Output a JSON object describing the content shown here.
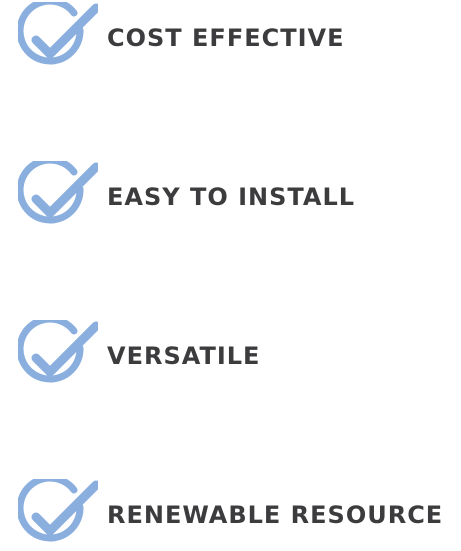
{
  "features": [
    {
      "label": "COST EFFECTIVE",
      "icon": "checkmark-circle-icon"
    },
    {
      "label": "EASY TO INSTALL",
      "icon": "checkmark-circle-icon"
    },
    {
      "label": "VERSATILE",
      "icon": "checkmark-circle-icon"
    },
    {
      "label": "RENEWABLE RESOURCE",
      "icon": "checkmark-circle-icon"
    }
  ],
  "colors": {
    "icon": "#8aaede",
    "text": "#3c3c3e",
    "background": "#ffffff"
  }
}
